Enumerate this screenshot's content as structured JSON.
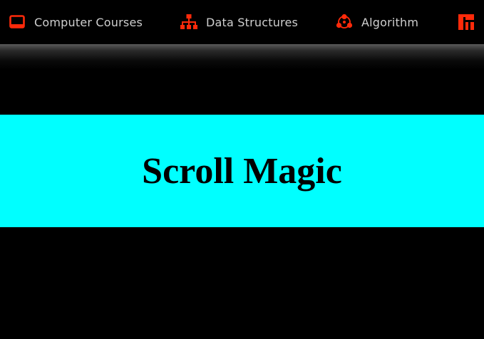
{
  "nav": {
    "items": [
      {
        "label": "Computer Courses",
        "icon": "laptop-icon"
      },
      {
        "label": "Data Structures",
        "icon": "sitemap-icon"
      },
      {
        "label": "Algorithm",
        "icon": "network-cycle-icon"
      },
      {
        "label": "",
        "icon": "dashboard-icon"
      }
    ]
  },
  "banner": {
    "title": "Scroll Magic"
  },
  "colors": {
    "accent": "#ff2a0a",
    "nav_text": "#cfcfcf",
    "banner_bg": "#00ffff",
    "page_bg": "#000000"
  }
}
